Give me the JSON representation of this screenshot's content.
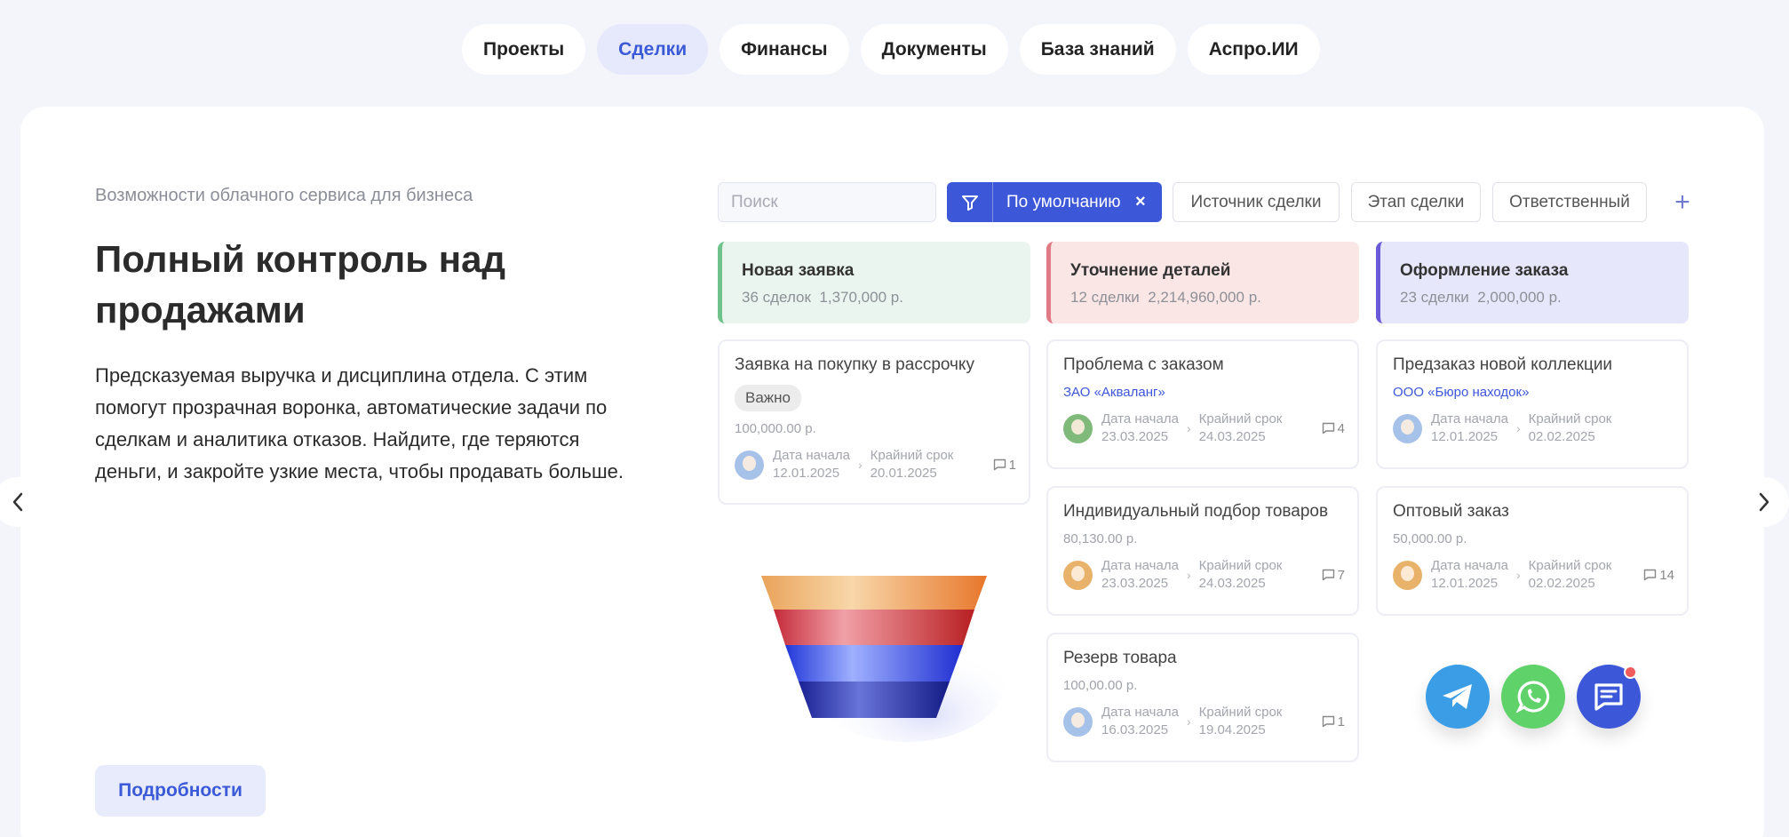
{
  "tabs": [
    {
      "label": "Проекты",
      "active": false
    },
    {
      "label": "Сделки",
      "active": true
    },
    {
      "label": "Финансы",
      "active": false
    },
    {
      "label": "Документы",
      "active": false
    },
    {
      "label": "База знаний",
      "active": false
    },
    {
      "label": "Аспро.ИИ",
      "active": false
    }
  ],
  "hero": {
    "eyebrow": "Возможности облачного сервиса для бизнеса",
    "title": "Полный контроль над продажами",
    "description": "Предсказуемая выручка и дисциплина отдела. С этим помогут прозрачная воронка, автоматические задачи по сделкам и аналитика отказов. Найдите, где теряются деньги, и закройте узкие места, чтобы продавать больше.",
    "more_button": "Подробности"
  },
  "filters": {
    "search_placeholder": "Поиск",
    "preset": "По умолчанию",
    "chips": [
      "Источник сделки",
      "Этап сделки",
      "Ответственный"
    ]
  },
  "stages": [
    {
      "name": "Новая заявка",
      "count": "36 сделок",
      "amount": "1,370,000 р.",
      "color": "#6fc28a",
      "bg": "#e9f5ee"
    },
    {
      "name": "Уточнение деталей",
      "count": "12 сделки",
      "amount": "2,214,960,000 р.",
      "color": "#e07b86",
      "bg": "#fbe6e6"
    },
    {
      "name": "Оформление заказа",
      "count": "23 сделки",
      "amount": "2,000,000 р.",
      "color": "#6a5ad8",
      "bg": "#e6e7fb"
    }
  ],
  "deals": {
    "start_label": "Дата начала",
    "due_label": "Крайний срок",
    "items": [
      {
        "name": "Заявка на покупку в рассрочку",
        "tag": "Важно",
        "price": "100,000.00 р.",
        "start": "12.01.2025",
        "due": "20.01.2025",
        "comments": "1",
        "avatar": "#a7c2e8"
      },
      {
        "name": "Проблема с заказом",
        "company": "ЗАО «Акваланг»",
        "start": "23.03.2025",
        "due": "24.03.2025",
        "comments": "4",
        "avatar": "#7fba7a"
      },
      {
        "name": "Индивидуальный подбор товаров",
        "price": "80,130.00 р.",
        "start": "23.03.2025",
        "due": "24.03.2025",
        "comments": "7",
        "avatar": "#e8b26a"
      },
      {
        "name": "Резерв товара",
        "price": "100,00.00 р.",
        "start": "16.03.2025",
        "due": "19.04.2025",
        "comments": "1",
        "avatar": "#a7c2e8"
      },
      {
        "name": "Предзаказ новой коллекции",
        "company": "ООО «Бюро находок»",
        "start": "12.01.2025",
        "due": "02.02.2025",
        "comments": "",
        "avatar": "#a7c2e8"
      },
      {
        "name": "Оптовый заказ",
        "price": "50,000.00 р.",
        "start": "12.01.2025",
        "due": "02.02.2025",
        "comments": "14",
        "avatar": "#e8b26a"
      }
    ]
  },
  "messengers": [
    {
      "icon": "telegram-icon",
      "color": "#3b9de6"
    },
    {
      "icon": "whatsapp-icon",
      "color": "#5fd26a"
    },
    {
      "icon": "chat-icon",
      "color": "#3d57d9"
    }
  ]
}
